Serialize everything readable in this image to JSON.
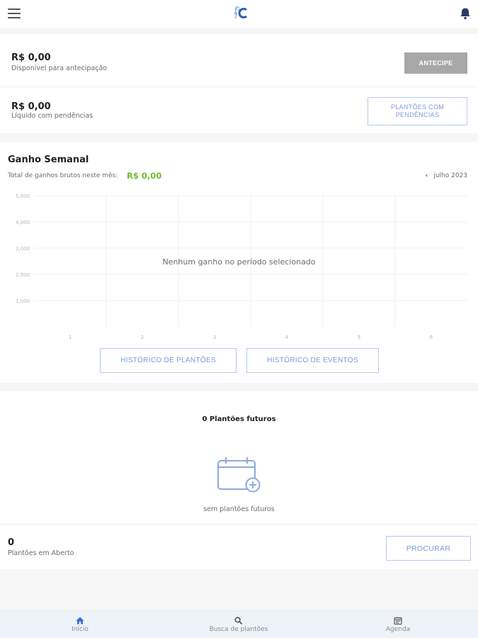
{
  "header": {
    "menu_icon": "hamburger-menu-icon",
    "logo_icon": "app-logo-icon",
    "notification_icon": "bell-icon"
  },
  "balance_available": {
    "value": "R$ 0,00",
    "label": "Disponível para antecipação",
    "button_label": "ANTECIPE"
  },
  "balance_pending": {
    "value": "R$ 0,00",
    "label": "Líquido com pendências",
    "button_label": "PLANTÕES COM PENDÊNCIAS"
  },
  "weekly": {
    "title": "Ganho Semanal",
    "subtitle": "Total de ganhos brutos neste mês:",
    "total": "R$ 0,00",
    "month": "julho 2023",
    "prev_icon": "chevron-left-icon",
    "empty_message": "Nenhum ganho no período selecionado",
    "history_shifts_label": "HISTÓRICO DE PLANTÕES",
    "history_events_label": "HISTÓRICO DE EVENTOS"
  },
  "chart_data": {
    "type": "bar",
    "categories": [
      "1",
      "2",
      "3",
      "4",
      "5",
      "6"
    ],
    "values": [
      0,
      0,
      0,
      0,
      0,
      0
    ],
    "y_ticks": [
      "5,000",
      "4,000",
      "3,000",
      "2,000",
      "1,000"
    ],
    "ylim": [
      0,
      5000
    ],
    "grid": true,
    "title": "",
    "xlabel": "",
    "ylabel": ""
  },
  "future": {
    "title": "0 Plantões futuros",
    "icon": "calendar-add-icon",
    "empty_message": "sem plantões futuros"
  },
  "open_shifts": {
    "value": "0",
    "label": "Plantões em Aberto",
    "button_label": "PROCURAR"
  },
  "bottom_nav": {
    "items": [
      {
        "label": "Início",
        "icon": "home-icon",
        "active": true
      },
      {
        "label": "Busca de plantões",
        "icon": "search-icon",
        "active": false
      },
      {
        "label": "Agenda",
        "icon": "calendar-icon",
        "active": false
      }
    ]
  },
  "colors": {
    "accent_blue": "#7c9ad8",
    "border_blue": "#b7c9ec",
    "green_total": "#6cbd2b",
    "disabled_button": "#a8a8a8",
    "nav_active": "#3b6fd6"
  }
}
